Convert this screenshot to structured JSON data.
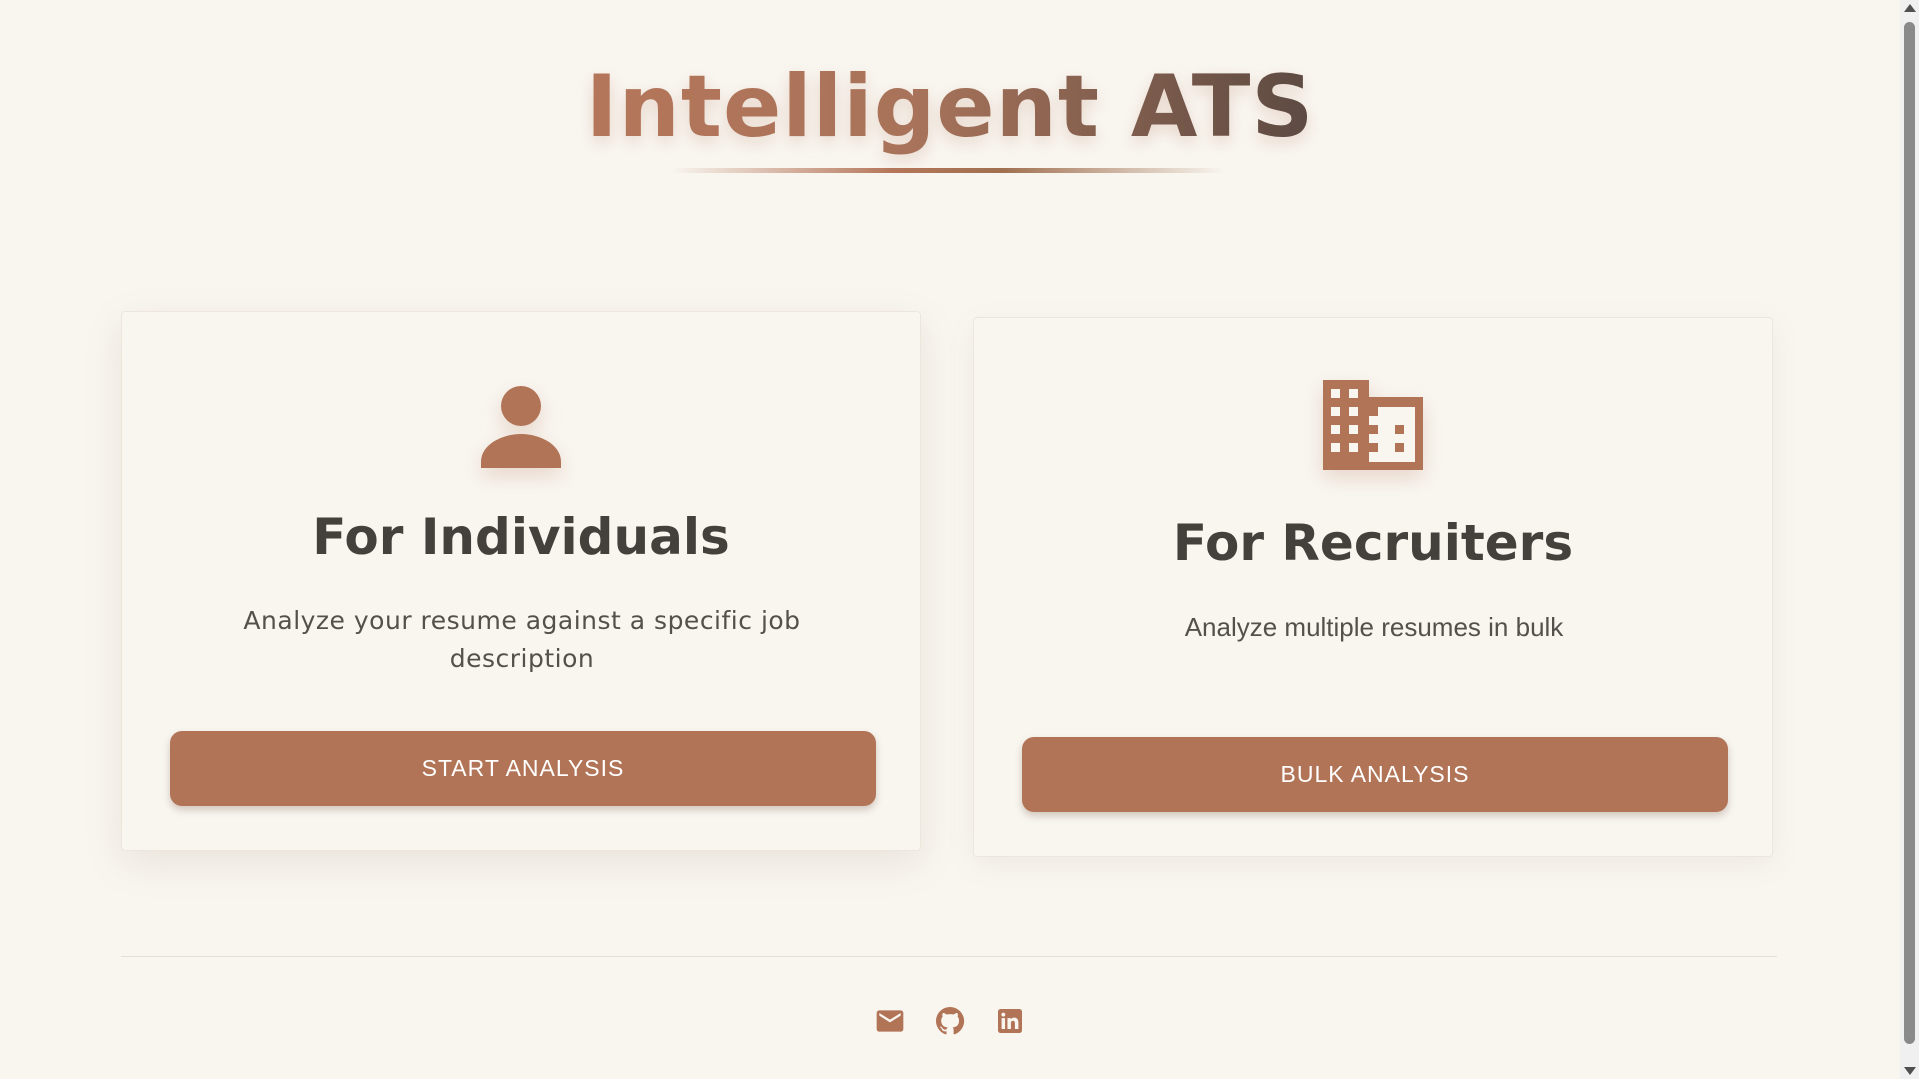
{
  "header": {
    "title": "Intelligent ATS"
  },
  "cards": {
    "individuals": {
      "icon": "person-icon",
      "title": "For Individuals",
      "description": "Analyze your resume against a specific job description",
      "button_label": "START ANALYSIS"
    },
    "recruiters": {
      "icon": "building-icon",
      "title": "For Recruiters",
      "description": "Analyze multiple resumes in bulk",
      "button_label": "BULK ANALYSIS"
    }
  },
  "footer": {
    "icons": [
      "email-icon",
      "github-icon",
      "linkedin-icon"
    ]
  },
  "colors": {
    "accent": "#b17457",
    "background": "#f9f6f0",
    "heading_text": "#44403c",
    "body_text": "#55504b"
  }
}
